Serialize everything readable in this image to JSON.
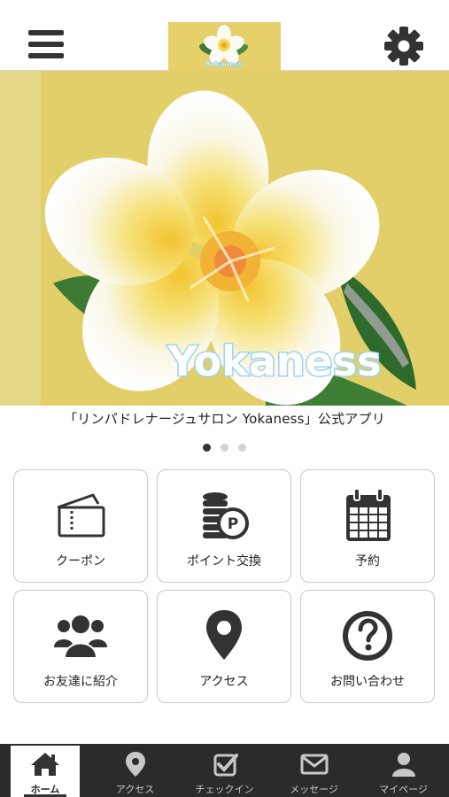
{
  "header": {
    "logo_text": "Yokaness"
  },
  "hero": {
    "brand_text": "Yokaness",
    "caption": "「リンパドレナージュサロン Yokaness」公式アプリ",
    "slides_count": 3,
    "active_slide": 1
  },
  "tiles": [
    {
      "label": "クーポン",
      "icon": "ticket-icon"
    },
    {
      "label": "ポイント交換",
      "icon": "coins-icon"
    },
    {
      "label": "予約",
      "icon": "calendar-icon"
    },
    {
      "label": "お友達に紹介",
      "icon": "group-icon"
    },
    {
      "label": "アクセス",
      "icon": "map-pin-icon"
    },
    {
      "label": "お問い合わせ",
      "icon": "question-icon"
    }
  ],
  "tabbar": [
    {
      "label": "ホーム",
      "icon": "home-icon",
      "active": true
    },
    {
      "label": "アクセス",
      "icon": "map-pin-icon",
      "active": false
    },
    {
      "label": "チェックイン",
      "icon": "checkin-icon",
      "active": false
    },
    {
      "label": "メッセージ",
      "icon": "mail-icon",
      "active": false
    },
    {
      "label": "マイページ",
      "icon": "user-icon",
      "active": false
    }
  ],
  "colors": {
    "hero_bg": "#e2cf6a",
    "tabbar_bg": "#2b2b2b",
    "icon_dark": "#333333"
  }
}
